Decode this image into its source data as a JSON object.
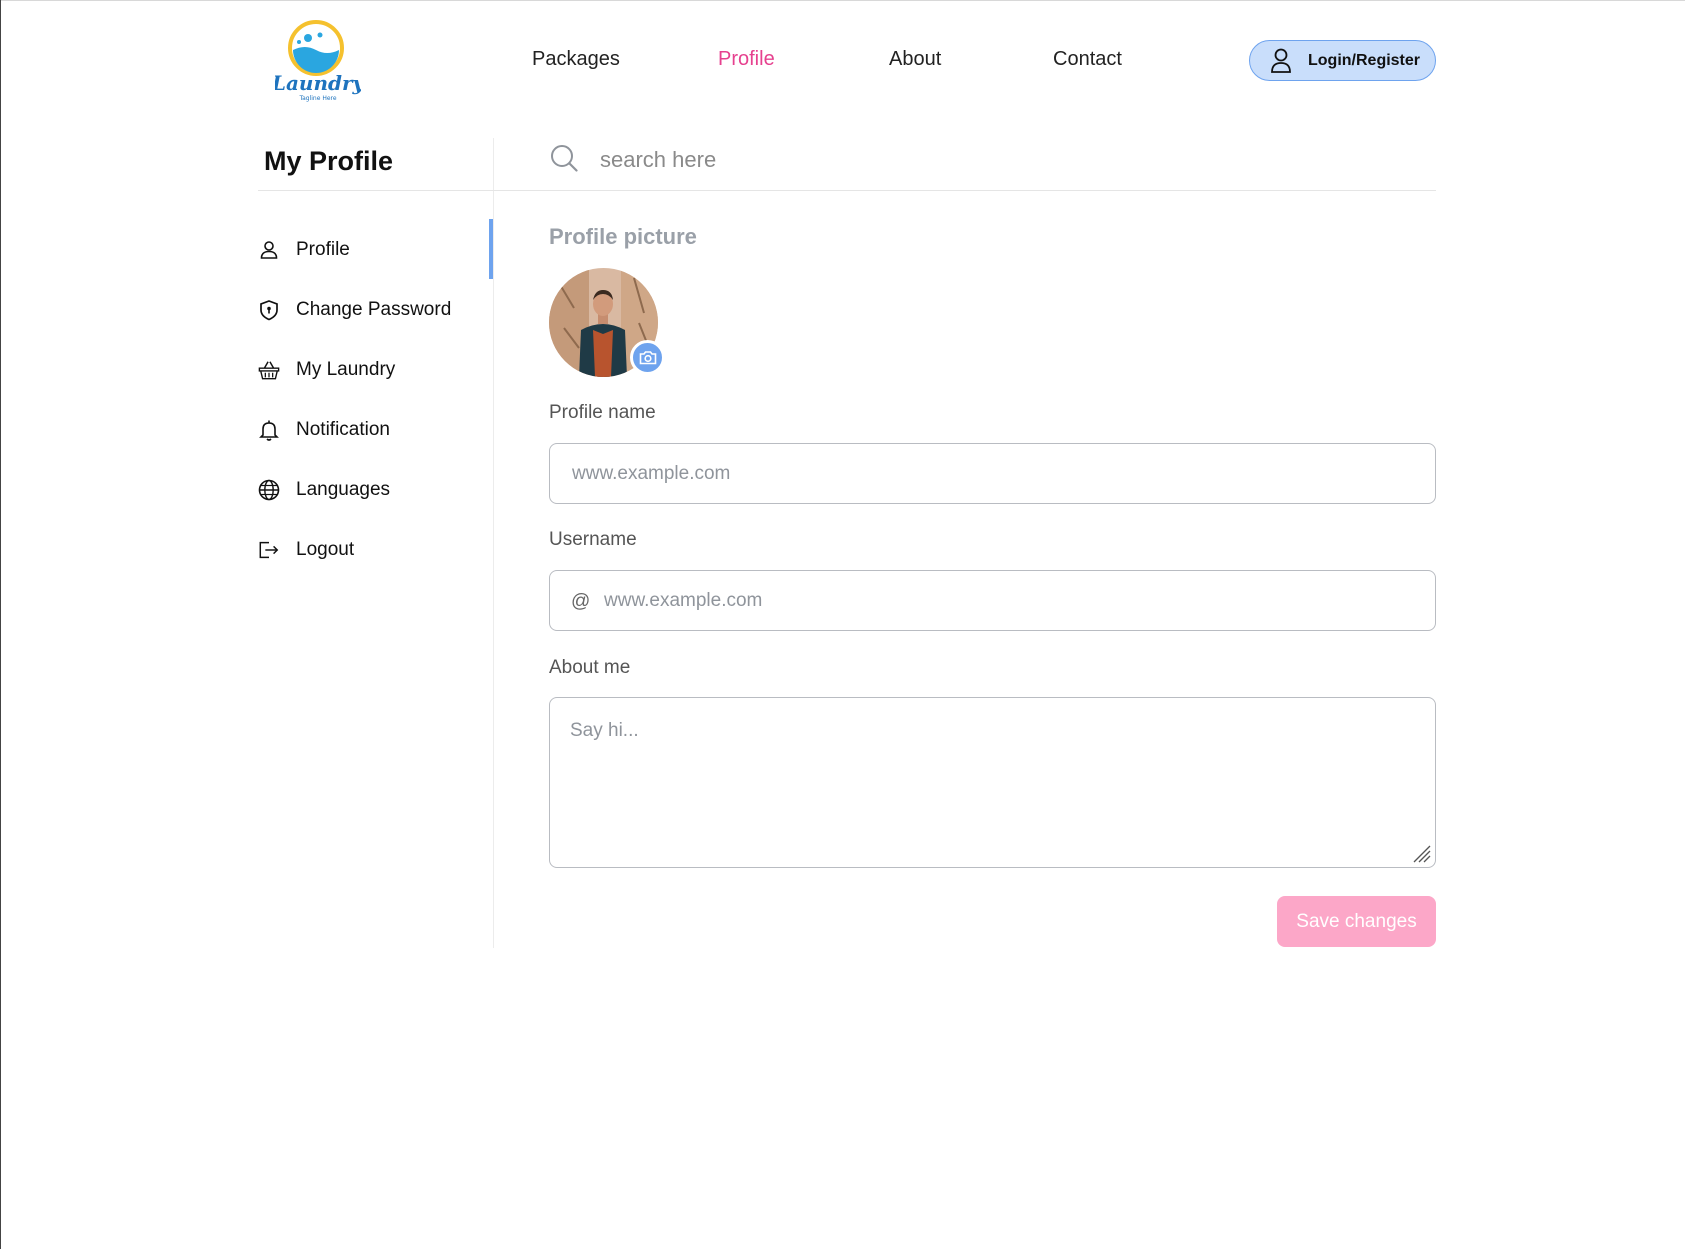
{
  "header": {
    "logo_text": "Laundry",
    "logo_tagline": "Tagline Here",
    "nav": [
      {
        "label": "Packages",
        "active": false
      },
      {
        "label": "Profile",
        "active": true
      },
      {
        "label": "About",
        "active": false
      },
      {
        "label": "Contact",
        "active": false
      }
    ],
    "login_label": "Login/Register",
    "active_color": "#e6418f"
  },
  "sidebar": {
    "title": "My Profile",
    "items": [
      {
        "label": "Profile",
        "icon": "user-icon",
        "active": true
      },
      {
        "label": "Change Password",
        "icon": "shield-icon",
        "active": false
      },
      {
        "label": "My Laundry",
        "icon": "basket-icon",
        "active": false
      },
      {
        "label": "Notification",
        "icon": "bell-icon",
        "active": false
      },
      {
        "label": "Languages",
        "icon": "globe-icon",
        "active": false
      },
      {
        "label": "Logout",
        "icon": "logout-icon",
        "active": false
      }
    ],
    "active_bar_color": "#6ea3ee"
  },
  "search": {
    "placeholder": "search here"
  },
  "main": {
    "profile_picture_title": "Profile picture",
    "profile_name_label": "Profile name",
    "profile_name_placeholder": "www.example.com",
    "username_label": "Username",
    "username_prefix": "@",
    "username_placeholder": "www.example.com",
    "about_label": "About me",
    "about_placeholder": "Say hi...",
    "save_label": "Save changes",
    "save_color": "#fca7c8"
  }
}
